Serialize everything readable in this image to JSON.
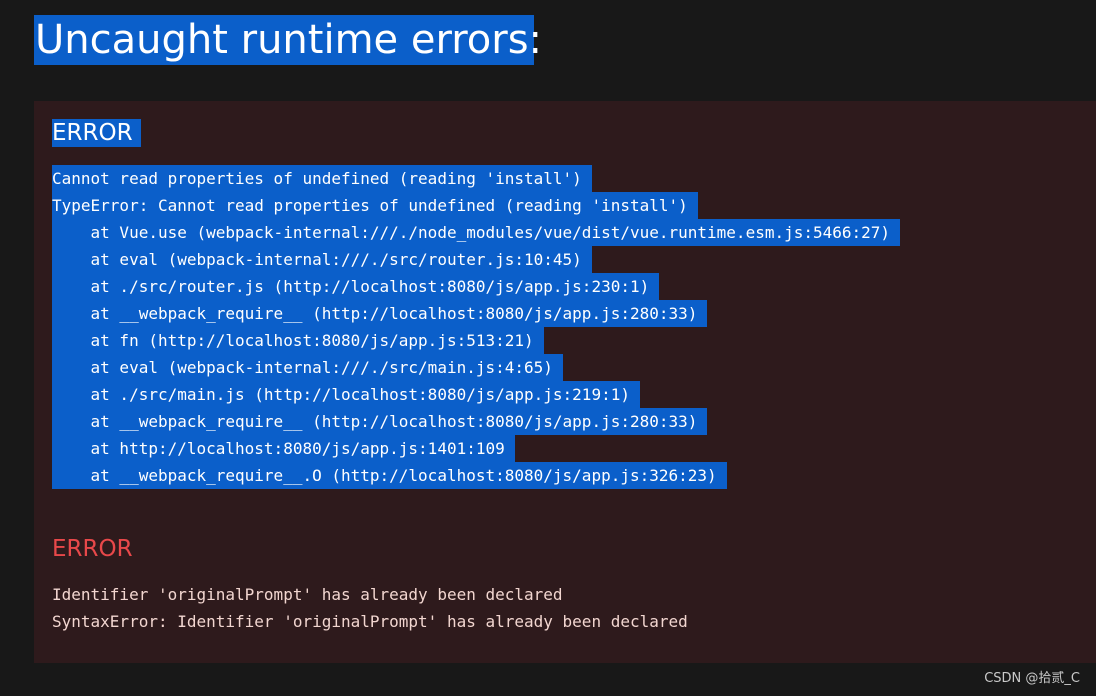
{
  "page": {
    "title": "Uncaught runtime errors:"
  },
  "errors": [
    {
      "heading": "ERROR",
      "lines": [
        "Cannot read properties of undefined (reading 'install')",
        "TypeError: Cannot read properties of undefined (reading 'install')",
        "    at Vue.use (webpack-internal:///./node_modules/vue/dist/vue.runtime.esm.js:5466:27)",
        "    at eval (webpack-internal:///./src/router.js:10:45)",
        "    at ./src/router.js (http://localhost:8080/js/app.js:230:1)",
        "    at __webpack_require__ (http://localhost:8080/js/app.js:280:33)",
        "    at fn (http://localhost:8080/js/app.js:513:21)",
        "    at eval (webpack-internal:///./src/main.js:4:65)",
        "    at ./src/main.js (http://localhost:8080/js/app.js:219:1)",
        "    at __webpack_require__ (http://localhost:8080/js/app.js:280:33)",
        "    at http://localhost:8080/js/app.js:1401:109",
        "    at __webpack_require__.O (http://localhost:8080/js/app.js:326:23)"
      ]
    },
    {
      "heading": "ERROR",
      "lines": [
        "Identifier 'originalPrompt' has already been declared",
        "SyntaxError: Identifier 'originalPrompt' has already been declared"
      ]
    }
  ],
  "watermark": "CSDN @拾贰_C",
  "colors": {
    "background": "#181818",
    "panel": "#2e1a1c",
    "selection": "#0b5fca",
    "error_red": "#e8484a",
    "text_light": "#f2d6d0"
  }
}
